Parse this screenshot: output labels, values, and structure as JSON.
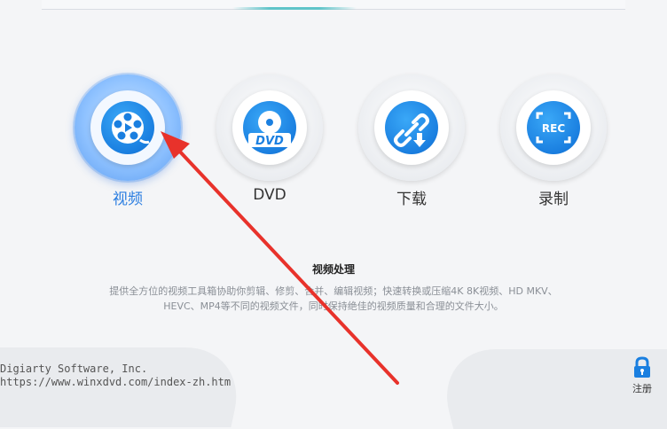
{
  "features": [
    {
      "id": "video",
      "label": "视频",
      "icon": "film-reel-icon",
      "active": true
    },
    {
      "id": "dvd",
      "label": "DVD",
      "icon": "dvd-disc-icon",
      "active": false
    },
    {
      "id": "download",
      "label": "下载",
      "icon": "link-download-icon",
      "active": false
    },
    {
      "id": "record",
      "label": "录制",
      "icon": "rec-icon",
      "active": false
    }
  ],
  "description": {
    "title": "视频处理",
    "line1": "提供全方位的视频工具箱协助你剪辑、修剪、合并、编辑视频；快速转换或压缩4K 8K视频、HD MKV、",
    "line2": "HEVC、MP4等不同的视频文件，同时保持绝佳的视频质量和合理的文件大小。"
  },
  "footer": {
    "company": "Digiarty Software, Inc.",
    "url": "https://www.winxdvd.com/index-zh.htm",
    "register_label": "注册"
  },
  "colors": {
    "accent": "#2a7de0",
    "icon_blue": "#1a7fe0",
    "arrow_red": "#e8322b"
  },
  "icons": {
    "rec_text": "REC",
    "dvd_text": "DVD"
  }
}
